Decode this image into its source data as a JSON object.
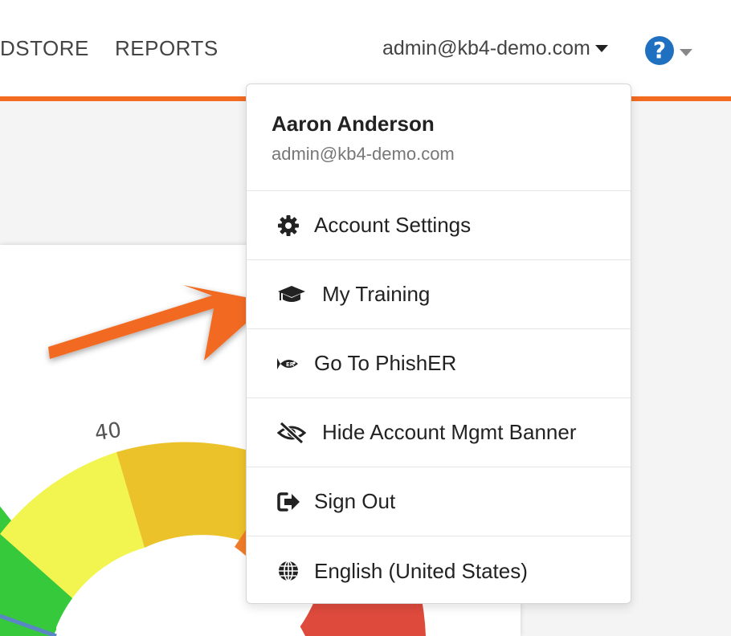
{
  "nav": {
    "items": [
      "DSTORE",
      "REPORTS"
    ],
    "user_email": "admin@kb4-demo.com",
    "help_glyph": "?"
  },
  "dropdown": {
    "user_name": "Aaron Anderson",
    "user_email": "admin@kb4-demo.com",
    "items": [
      {
        "label": "Account Settings",
        "icon": "gear-icon"
      },
      {
        "label": "My Training",
        "icon": "graduation-cap-icon"
      },
      {
        "label": "Go To PhishER",
        "icon": "phisher-fish-icon"
      },
      {
        "label": "Hide Account Mgmt Banner",
        "icon": "eye-slash-icon"
      },
      {
        "label": "Sign Out",
        "icon": "sign-out-icon"
      },
      {
        "label": "English (United States)",
        "icon": "globe-icon"
      }
    ]
  },
  "gauge": {
    "visible_label": "40",
    "colors": [
      "#35c93b",
      "#f2f54f",
      "#ecc22a",
      "#f07d2a",
      "#de4a3c"
    ]
  },
  "colors": {
    "accent": "#f26b21",
    "help_blue": "#1f70c1"
  }
}
